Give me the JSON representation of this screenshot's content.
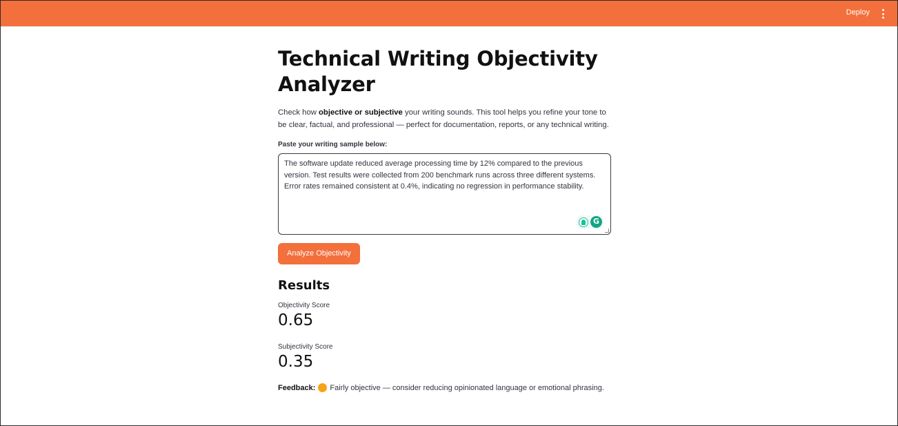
{
  "header": {
    "deploy_label": "Deploy",
    "menu_icon": "kebab-menu-icon",
    "accent_color": "#f36f3b"
  },
  "main": {
    "title": "Technical Writing Objectivity Analyzer",
    "intro": {
      "part1": "Check how ",
      "bold": "objective or subjective",
      "part2": " your writing sounds. This tool helps you refine your tone to be clear, factual, and professional — perfect for documentation, reports, or any technical writing."
    },
    "input_label": "Paste your writing sample below:",
    "input_value": "The software update reduced average processing time by 12% compared to the previous version. Test results were collected from 200 benchmark runs across three different systems. Error rates remained consistent at 0.4%, indicating no regression in performance stability.",
    "grammarly_letter": "G",
    "analyze_button": "Analyze Objectivity"
  },
  "results": {
    "heading": "Results",
    "objectivity_label": "Objectivity Score",
    "objectivity_value": "0.65",
    "subjectivity_label": "Subjectivity Score",
    "subjectivity_value": "0.35",
    "feedback_label": "Feedback:",
    "feedback_text": "Fairly objective — consider reducing opinionated language or emotional phrasing.",
    "feedback_dot_color": "#f7a21b"
  }
}
